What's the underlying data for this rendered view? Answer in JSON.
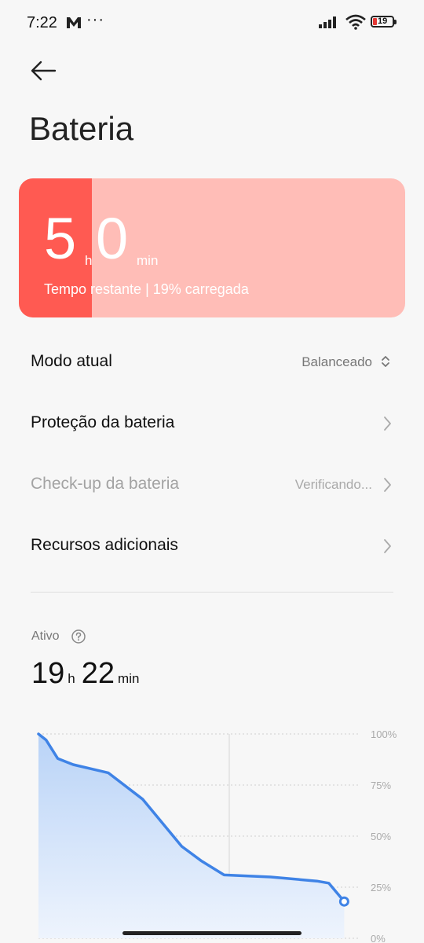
{
  "status_bar": {
    "time": "7:22",
    "dots": "···",
    "battery_level": "19"
  },
  "header": {
    "title": "Bateria"
  },
  "battery_card": {
    "hours": "5",
    "hours_unit": "h",
    "minutes": "0",
    "minutes_unit": "min",
    "subtitle": "Tempo restante | 19% carregada",
    "charge_percent": 19
  },
  "menu": {
    "mode_label": "Modo atual",
    "mode_value": "Balanceado",
    "protection_label": "Proteção da bateria",
    "checkup_label": "Check-up da bateria",
    "checkup_value": "Verificando...",
    "extra_label": "Recursos adicionais"
  },
  "active": {
    "label": "Ativo",
    "hours": "19",
    "hours_unit": "h",
    "minutes": "22",
    "minutes_unit": "min"
  },
  "chart_data": {
    "type": "area",
    "y_ticks": [
      "100%",
      "75%",
      "50%",
      "25%",
      "0%"
    ],
    "ylim": [
      0,
      100
    ],
    "x_range": [
      0,
      100
    ],
    "grid": true,
    "line_color": "#3f83e6",
    "series": [
      {
        "x": [
          0,
          2.4,
          6,
          10.8,
          21.7,
          32.5,
          44.6,
          50.6,
          57.8,
          72.3,
          86.7,
          90.4,
          95.2
        ],
        "values": [
          100,
          97,
          88,
          85,
          81,
          68,
          45,
          38,
          31,
          30,
          28,
          27,
          18
        ]
      }
    ]
  }
}
